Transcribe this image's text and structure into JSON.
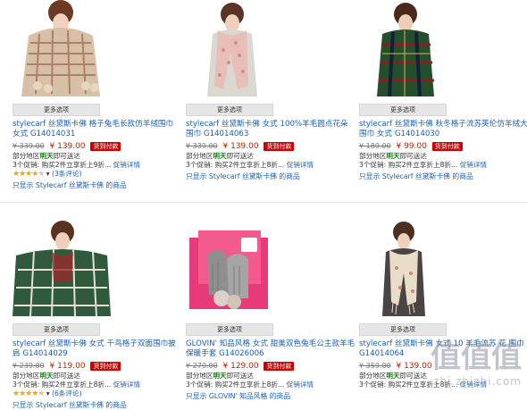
{
  "more_options_label": "更多选项",
  "shipping_prefix": "部分地区",
  "shipping_day": "明天",
  "shipping_suffix": "即可送达",
  "promo_text": "3个促销: 购买2件立享折上9折...",
  "promo_text_cut": "3个促销: 购买2件立享折上8折...",
  "promo_link": "促销详情",
  "cod_label": "货到付款",
  "products": [
    {
      "title": "stylecarf 丝黛斯卡佛 格子兔毛长款仿羊绒围巾 女式 G14014031",
      "old_price": "¥ 339.00",
      "new_price": "¥ 139.00",
      "rating": 4,
      "review_text": "(3条评论)",
      "only_text": "只显示 Stylecarf 丝黛斯卡佛 的商品"
    },
    {
      "title": "stylecarf 丝黛斯卡佛 女式 100%羊毛圆点花朵 围巾 G14014063",
      "old_price": "¥ 339.00",
      "new_price": "¥ 139.00",
      "only_text": "只显示 Stylecarf 丝黛斯卡佛 的商品"
    },
    {
      "title": "stylecarf 丝黛斯卡佛 秋冬格子流苏英伦仿羊绒大围巾 女式 G14014030",
      "old_price": "¥ 189.00",
      "new_price": "¥ 99.00",
      "only_text": "只显示 Stylecarf 丝黛斯卡佛 的商品"
    },
    {
      "title": "stylecarf 丝黛斯卡佛 女式 千鸟格子双面围巾披肩 G14014029",
      "old_price": "¥ 239.00",
      "new_price": "¥ 119.00",
      "rating": 4.5,
      "review_text": "(6条评论)",
      "only_text": "只显示 Stylecarf 丝黛斯卡佛 的商品"
    },
    {
      "title": "GLOVIN' 知品风格 女式 甜美双色兔毛公主款羊毛保暖手套 G14026006",
      "old_price": "¥ 279.00",
      "new_price": "¥ 129.00",
      "only_text": "只显示 GLOVIN' 知品风格 的商品"
    },
    {
      "title": "stylecarf 丝黛斯卡佛 女式 10 羊毛流苏 花 围巾 G14014064",
      "old_price": "¥ 359.00",
      "new_price": "¥ 139.00",
      "only_text": "只显示 Stylecarf 丝黛斯卡佛 的商品"
    }
  ],
  "watermark": {
    "main": "值值值",
    "sub": "zhi.zhizhi.com"
  }
}
